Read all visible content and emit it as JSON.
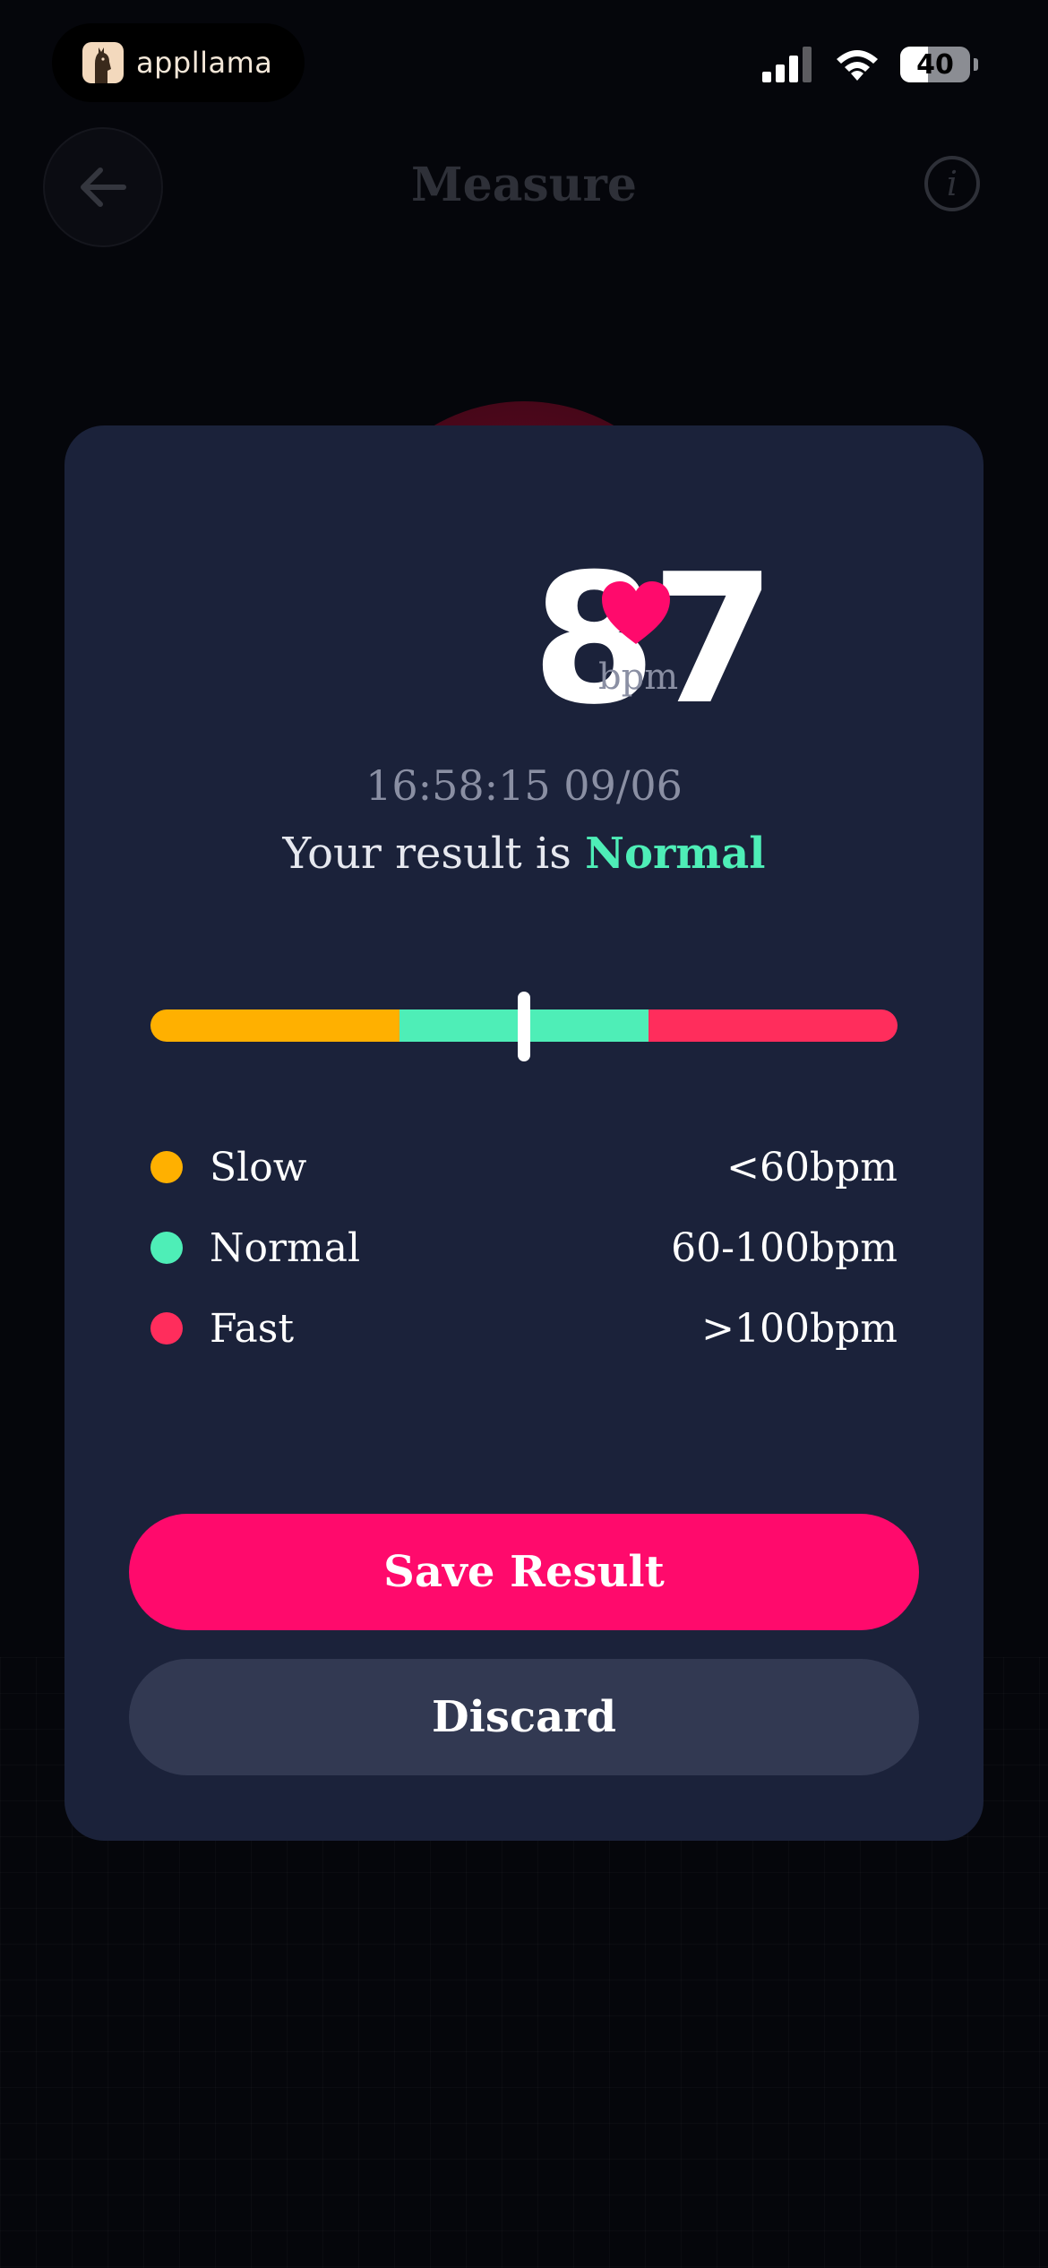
{
  "status_bar": {
    "brand": "appllama",
    "battery": "40"
  },
  "header": {
    "title": "Measure",
    "info_label": "i"
  },
  "result": {
    "bpm": "87",
    "unit": "bpm",
    "timestamp": "16:58:15 09/06",
    "prefix": "Your result is",
    "category": "Normal",
    "marker_position_fraction": 0.5
  },
  "legend": [
    {
      "label": "Slow",
      "range": "<60bpm",
      "color": "#ffb000"
    },
    {
      "label": "Normal",
      "range": "60-100bpm",
      "color": "#4eeeb7"
    },
    {
      "label": "Fast",
      "range": ">100bpm",
      "color": "#ff2d5c"
    }
  ],
  "actions": {
    "save_label": "Save Result",
    "discard_label": "Discard"
  },
  "colors": {
    "accent": "#ff0a6c",
    "card": "#1b223a",
    "background": "#05060b"
  }
}
